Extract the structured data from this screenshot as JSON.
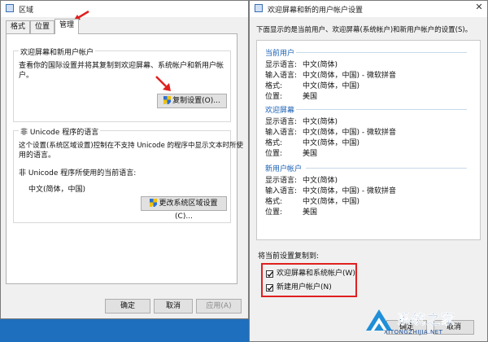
{
  "left_window": {
    "title": "区域",
    "tabs": [
      "格式",
      "位置",
      "管理"
    ],
    "welcome_group": {
      "title": "欢迎屏幕和新用户帐户",
      "description": "查看你的国际设置并将其复制到欢迎屏幕、系统帐户和新用户帐户。",
      "copy_button": "复制设置(O)..."
    },
    "unicode_group": {
      "title": "非 Unicode 程序的语言",
      "description_line1": "这个设置(系统区域设置)控制在不支持 Unicode 的程序中显示文本时所使",
      "description_line2": "用的语言。",
      "current_label": "非 Unicode 程序所使用的当前语言:",
      "current_value": "中文(简体，中国)",
      "change_button": "更改系统区域设置(C)..."
    },
    "buttons": {
      "ok": "确定",
      "cancel": "取消",
      "apply": "应用(A)"
    }
  },
  "right_window": {
    "title": "欢迎屏幕和新的用户帐户设置",
    "intro": "下面显示的是当前用户、欢迎屏幕(系统帐户)和新用户帐户的设置(S)。",
    "sections": [
      {
        "header": "当前用户",
        "rows": [
          {
            "label": "显示语言:",
            "value": "中文(简体)"
          },
          {
            "label": "输入语言:",
            "value": "中文(简体，中国) - 微软拼音"
          },
          {
            "label": "格式:",
            "value": "中文(简体，中国)"
          },
          {
            "label": "位置:",
            "value": "美国"
          }
        ]
      },
      {
        "header": "欢迎屏幕",
        "rows": [
          {
            "label": "显示语言:",
            "value": "中文(简体)"
          },
          {
            "label": "输入语言:",
            "value": "中文(简体，中国) - 微软拼音"
          },
          {
            "label": "格式:",
            "value": "中文(简体，中国)"
          },
          {
            "label": "位置:",
            "value": "美国"
          }
        ]
      },
      {
        "header": "新用户帐户",
        "rows": [
          {
            "label": "显示语言:",
            "value": "中文(简体)"
          },
          {
            "label": "输入语言:",
            "value": "中文(简体，中国) - 微软拼音"
          },
          {
            "label": "格式:",
            "value": "中文(简体，中国)"
          },
          {
            "label": "位置:",
            "value": "美国"
          }
        ]
      }
    ],
    "copy_label": "将当前设置复制到:",
    "checkbox1": "欢迎屏幕和系统帐户(W)",
    "checkbox1_checked": true,
    "checkbox2": "新建用户帐户(N)",
    "checkbox2_checked": true,
    "ok_button_partial": "确定",
    "cancel_button_partial": "取消"
  },
  "watermark": {
    "brand": "系统之家",
    "url": "XITONGZHIJIA.NET"
  },
  "colors": {
    "highlight_red": "#e02020",
    "accent_blue": "#1a5fb4",
    "taskbar_blue": "#1e6fbd"
  },
  "icons": [
    "region-icon",
    "uac-shield-icon",
    "close-icon",
    "red-arrow-icon",
    "checkmark-icon",
    "brand-logo-icon"
  ]
}
